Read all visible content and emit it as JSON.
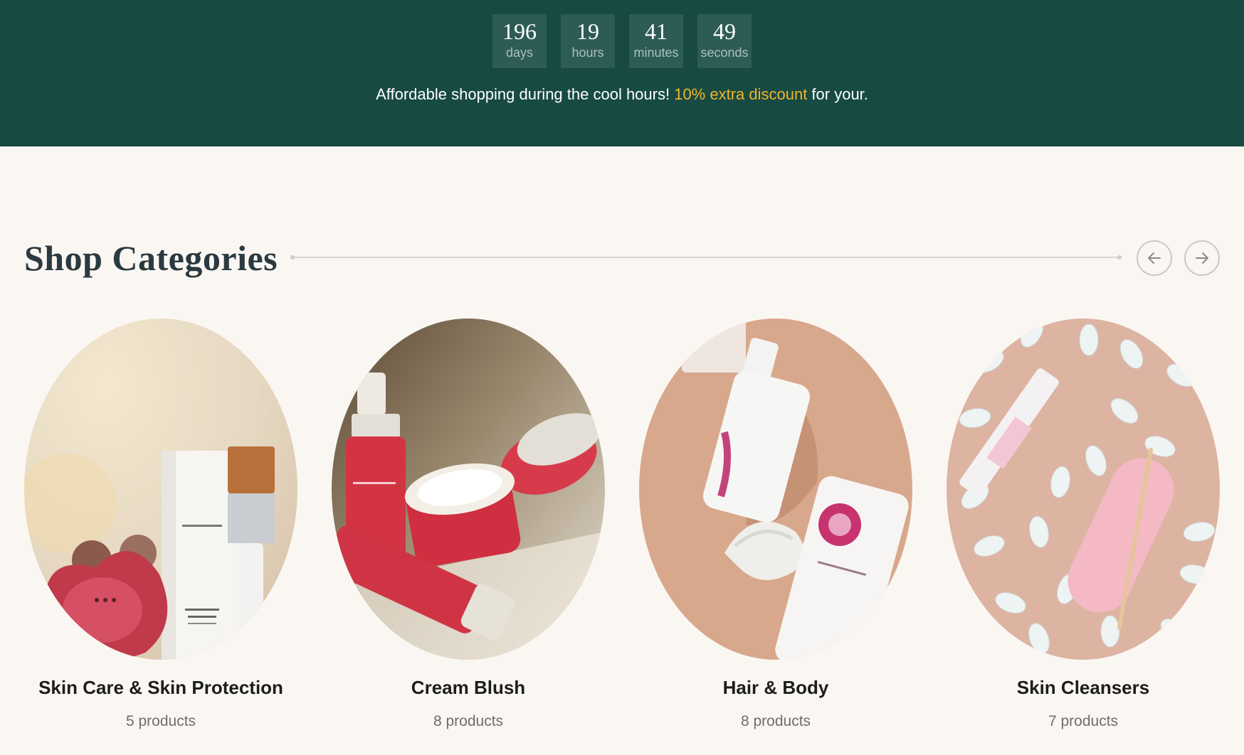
{
  "countdown": {
    "days": {
      "value": "196",
      "unit": "days"
    },
    "hours": {
      "value": "19",
      "unit": "hours"
    },
    "minutes": {
      "value": "41",
      "unit": "minutes"
    },
    "seconds": {
      "value": "49",
      "unit": "seconds"
    }
  },
  "promo": {
    "text_before": "Affordable shopping during the cool hours! ",
    "highlight": "10% extra discount",
    "text_after": " for your."
  },
  "colors": {
    "banner_bg": "#174a43",
    "accent": "#f0b429",
    "page_bg": "#faf7f3"
  },
  "categories_section": {
    "title": "Shop Categories",
    "prev_icon": "arrow-left-icon",
    "next_icon": "arrow-right-icon",
    "items": [
      {
        "name": "Skin Care & Skin Protection",
        "count": "5 products",
        "image": "skincare-device-and-brush"
      },
      {
        "name": "Cream Blush",
        "count": "8 products",
        "image": "red-cream-jars"
      },
      {
        "name": "Hair & Body",
        "count": "8 products",
        "image": "hair-spray-and-tube"
      },
      {
        "name": "Skin Cleansers",
        "count": "7 products",
        "image": "press-on-nails"
      }
    ]
  }
}
